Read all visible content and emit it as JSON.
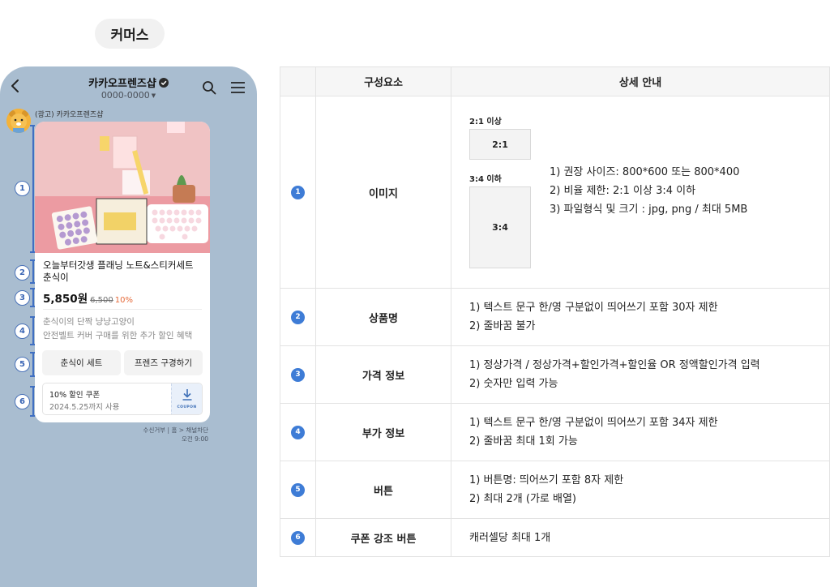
{
  "page": {
    "title": "커머스"
  },
  "phone": {
    "channel_name": "카카오프렌즈샵",
    "channel_number": "0000-0000",
    "sender_label": "(광고) 카카오프렌즈샵",
    "markers": [
      "1",
      "2",
      "3",
      "4",
      "5",
      "6"
    ],
    "card": {
      "title_lines": [
        "오늘부터갓생 플래닝 노트&스티커세트",
        "춘식이"
      ],
      "price_current": "5,850원",
      "price_original": "6,500",
      "price_discount": "10%",
      "sub_info_lines": [
        "춘식이의 단짝 냥냥고양이",
        "안전벨트 커버 구매를 위한 추가 할인 혜택"
      ],
      "buttons": [
        "춘식이 세트",
        "프렌즈 구경하기"
      ],
      "coupon": {
        "title": "10% 할인 쿠폰",
        "date": "2024.5.25까지 사용",
        "tag": "COUPON"
      }
    },
    "footer_links": "수신거부 | 홈 > 채널차단",
    "timestamp": "오전 9:00"
  },
  "table": {
    "headers": [
      "구성요소",
      "상세 안내"
    ],
    "rows": [
      {
        "num": "1",
        "name": "이미지",
        "ratio_a_label": "2:1 이상",
        "ratio_a_box": "2:1",
        "ratio_b_label": "3:4 이하",
        "ratio_b_box": "3:4",
        "details": [
          "1) 권장 사이즈: 800*600 또는 800*400",
          "2) 비율 제한: 2:1 이상 3:4 이하",
          "3) 파일형식 및 크기 : jpg, png / 최대 5MB"
        ]
      },
      {
        "num": "2",
        "name": "상품명",
        "details": [
          "1) 텍스트 문구 한/영 구분없이 띄어쓰기 포함 30자 제한",
          "2) 줄바꿈 불가"
        ]
      },
      {
        "num": "3",
        "name": "가격 정보",
        "details": [
          "1) 정상가격 / 정상가격+할인가격+할인율 OR 정액할인가격 입력",
          "2) 숫자만 입력 가능"
        ]
      },
      {
        "num": "4",
        "name": "부가 정보",
        "details": [
          "1) 텍스트 문구 한/영 구분없이 띄어쓰기 포함 34자 제한",
          "2) 줄바꿈 최대 1회 가능"
        ]
      },
      {
        "num": "5",
        "name": "버튼",
        "details": [
          "1) 버튼명: 띄어쓰기 포함 8자 제한",
          "2) 최대 2개 (가로 배열)"
        ]
      },
      {
        "num": "6",
        "name": "쿠폰 강조 버튼",
        "details": [
          "캐러셀당 최대 1개"
        ]
      }
    ]
  },
  "colors": {
    "phone_bg": "#a9bdd0",
    "accent_blue": "#3e7cd6",
    "discount": "#e56a3a"
  }
}
